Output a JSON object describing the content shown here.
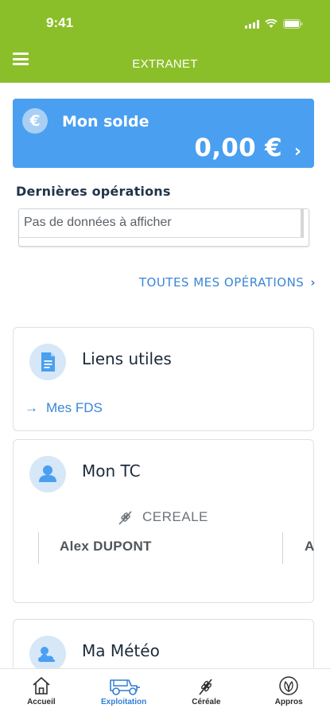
{
  "status_bar": {
    "time": "9:41"
  },
  "app_bar": {
    "title": "EXTRANET",
    "menu_icon": "hamburger-menu-icon"
  },
  "balance": {
    "label": "Mon solde",
    "amount": "0,00 €",
    "currency_icon": "€",
    "chevron": "›",
    "colors": {
      "background": "#4a9ff0"
    }
  },
  "operations": {
    "title": "Dernières opérations",
    "empty_text": "Pas de données à afficher",
    "all_link": "TOUTES MES OPÉRATIONS",
    "all_link_chevron": "›"
  },
  "useful_links": {
    "title": "Liens utiles",
    "icon": "document-icon",
    "links": [
      {
        "arrow": "→",
        "label": "Mes FDS"
      }
    ]
  },
  "tc": {
    "title": "Mon TC",
    "icon": "person-icon",
    "category": "CEREALE",
    "name": "Alex DUPONT",
    "next_name_partial": "A"
  },
  "meteo": {
    "title": "Ma Météo",
    "icon": "weather-icon"
  },
  "bottom_nav": [
    {
      "label": "Accueil",
      "icon": "home-icon",
      "active": false
    },
    {
      "label": "Exploitation",
      "icon": "tractor-icon",
      "active": true
    },
    {
      "label": "Céréale",
      "icon": "wheat-icon",
      "active": false
    },
    {
      "label": "Appros",
      "icon": "leaf-icon",
      "active": false
    }
  ],
  "colors": {
    "brand_green": "#8bbf2a",
    "accent_blue": "#3a86d6",
    "card_blue": "#4a9ff0"
  }
}
